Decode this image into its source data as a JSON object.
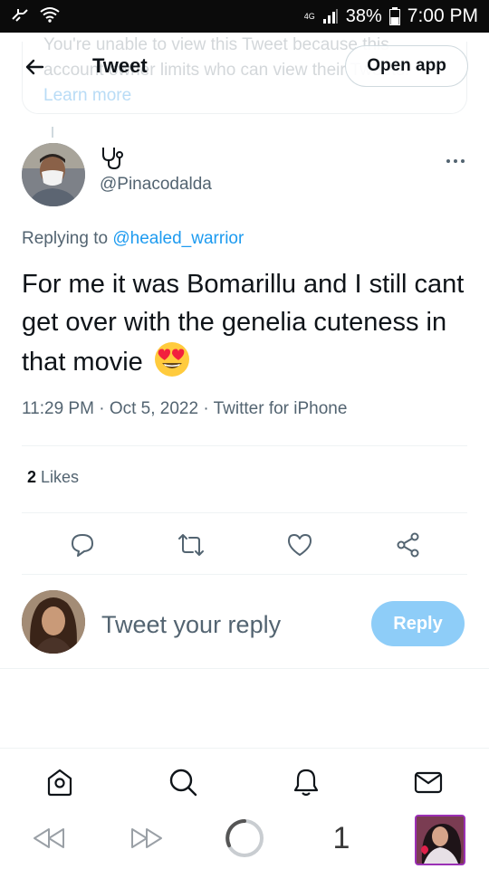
{
  "status_bar": {
    "network": "4G",
    "battery": "38%",
    "time": "7:00 PM"
  },
  "header": {
    "title": "Tweet",
    "open_app_label": "Open app",
    "ghost_notice": "You're unable to view this Tweet because this account owner limits who can view their Tweets.",
    "ghost_learn_more": "Learn more"
  },
  "tweet": {
    "author_handle": "@Pinacodalda",
    "replying_prefix": "Replying to",
    "replying_to": "@healed_warrior",
    "text": "For me it was Bomarillu and I still cant get over with the genelia cuteness in that movie",
    "emoji_icon": "smiling-face-with-heart-eyes-emoji",
    "time": "11:29 PM",
    "date": "Oct 5, 2022",
    "source": "Twitter for iPhone",
    "separator": "·",
    "likes_count": "2",
    "likes_label": "Likes"
  },
  "composer": {
    "placeholder": "Tweet your reply",
    "reply_label": "Reply"
  },
  "tabbar": {
    "items": [
      "home-icon",
      "search-icon",
      "notifications-icon",
      "messages-icon"
    ]
  },
  "browser": {
    "tab_count": "1"
  },
  "colors": {
    "accent": "#1d9bf0",
    "reply_button": "#8ecdf8",
    "secondary_text": "#536471",
    "primary_text": "#0f1419"
  }
}
